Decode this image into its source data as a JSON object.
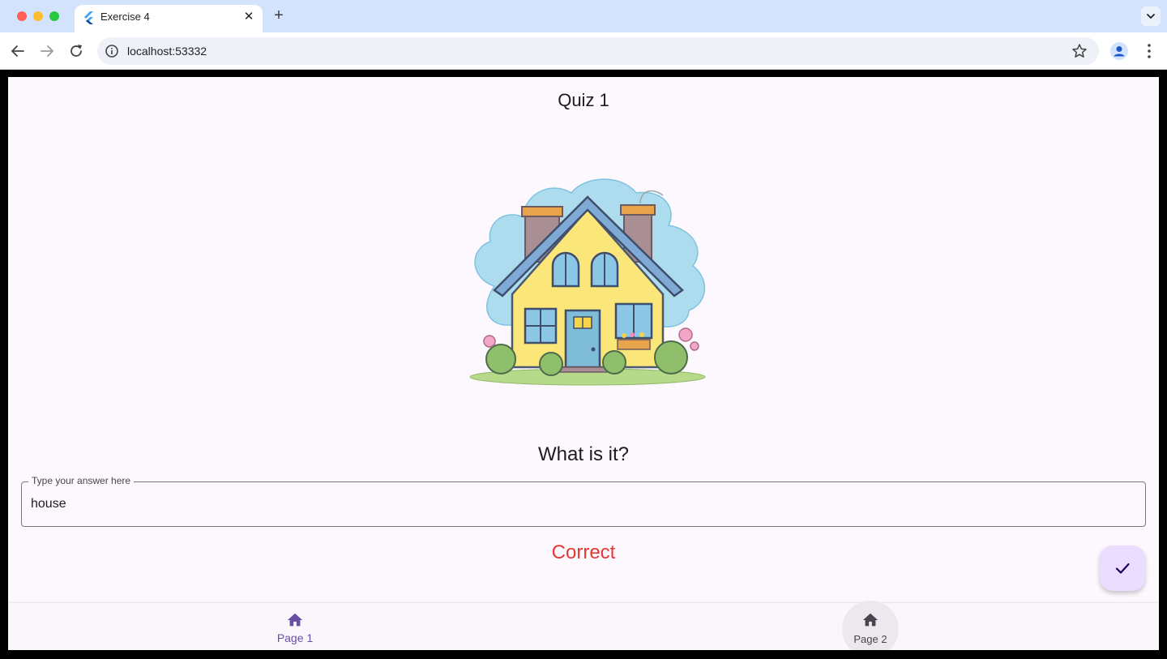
{
  "browser": {
    "tab_title": "Exercise 4",
    "new_tab_symbol": "+",
    "close_symbol": "✕",
    "url": "localhost:53332"
  },
  "app": {
    "title": "Quiz 1",
    "question": "What is it?",
    "answer_field": {
      "label": "Type your answer here",
      "value": "house"
    },
    "result_text": "Correct",
    "submit_icon": "check-icon",
    "bottom_nav": {
      "items": [
        {
          "label": "Page 1",
          "icon": "home-icon",
          "selected": true
        },
        {
          "label": "Page 2",
          "icon": "home-icon",
          "selected": false
        }
      ]
    }
  },
  "colors": {
    "primary": "#6750a4",
    "result": "#e53935",
    "fab": "#eaddff"
  }
}
